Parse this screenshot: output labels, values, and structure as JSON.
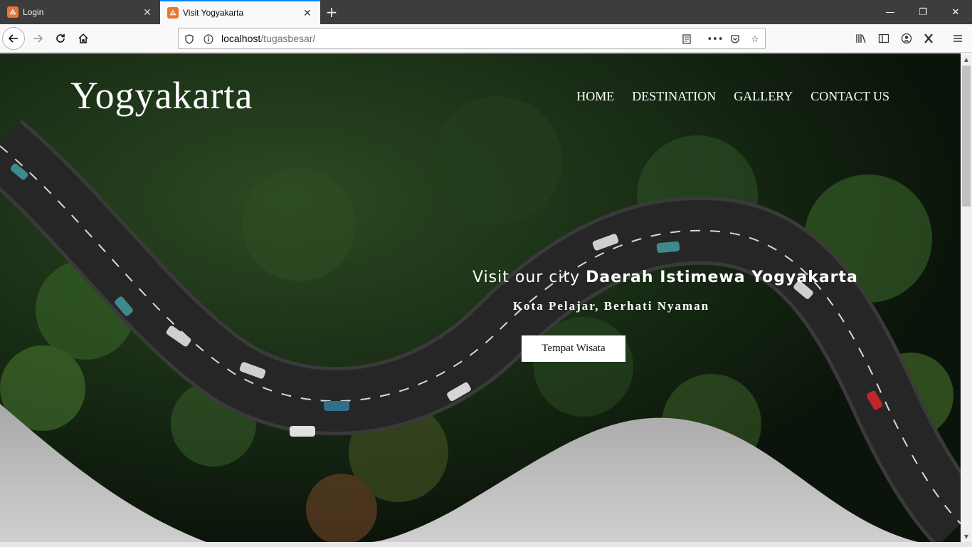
{
  "browser": {
    "tabs": [
      {
        "title": "Login",
        "favicon": "xampp-icon",
        "active": false
      },
      {
        "title": "Visit Yogyakarta",
        "favicon": "xampp-icon",
        "active": true
      }
    ],
    "url": {
      "host": "localhost",
      "path": "/tugasbesar/"
    },
    "favicon_glyph": "ꟷ"
  },
  "site": {
    "logo": "Yogyakarta",
    "nav": [
      "HOME",
      "DESTINATION",
      "GALLERY",
      "CONTACT US"
    ],
    "hero": {
      "heading_prefix": "Visit our city ",
      "heading_bold": "Daerah Istimewa Yogyakarta",
      "subheading": "Kota Pelajar, Berhati Nyaman",
      "button": "Tempat Wisata"
    }
  },
  "colors": {
    "accent": "#0a84ff",
    "forest": "#1f3a1f",
    "road": "#2a2a2a",
    "wave": "#bdbdbd"
  }
}
